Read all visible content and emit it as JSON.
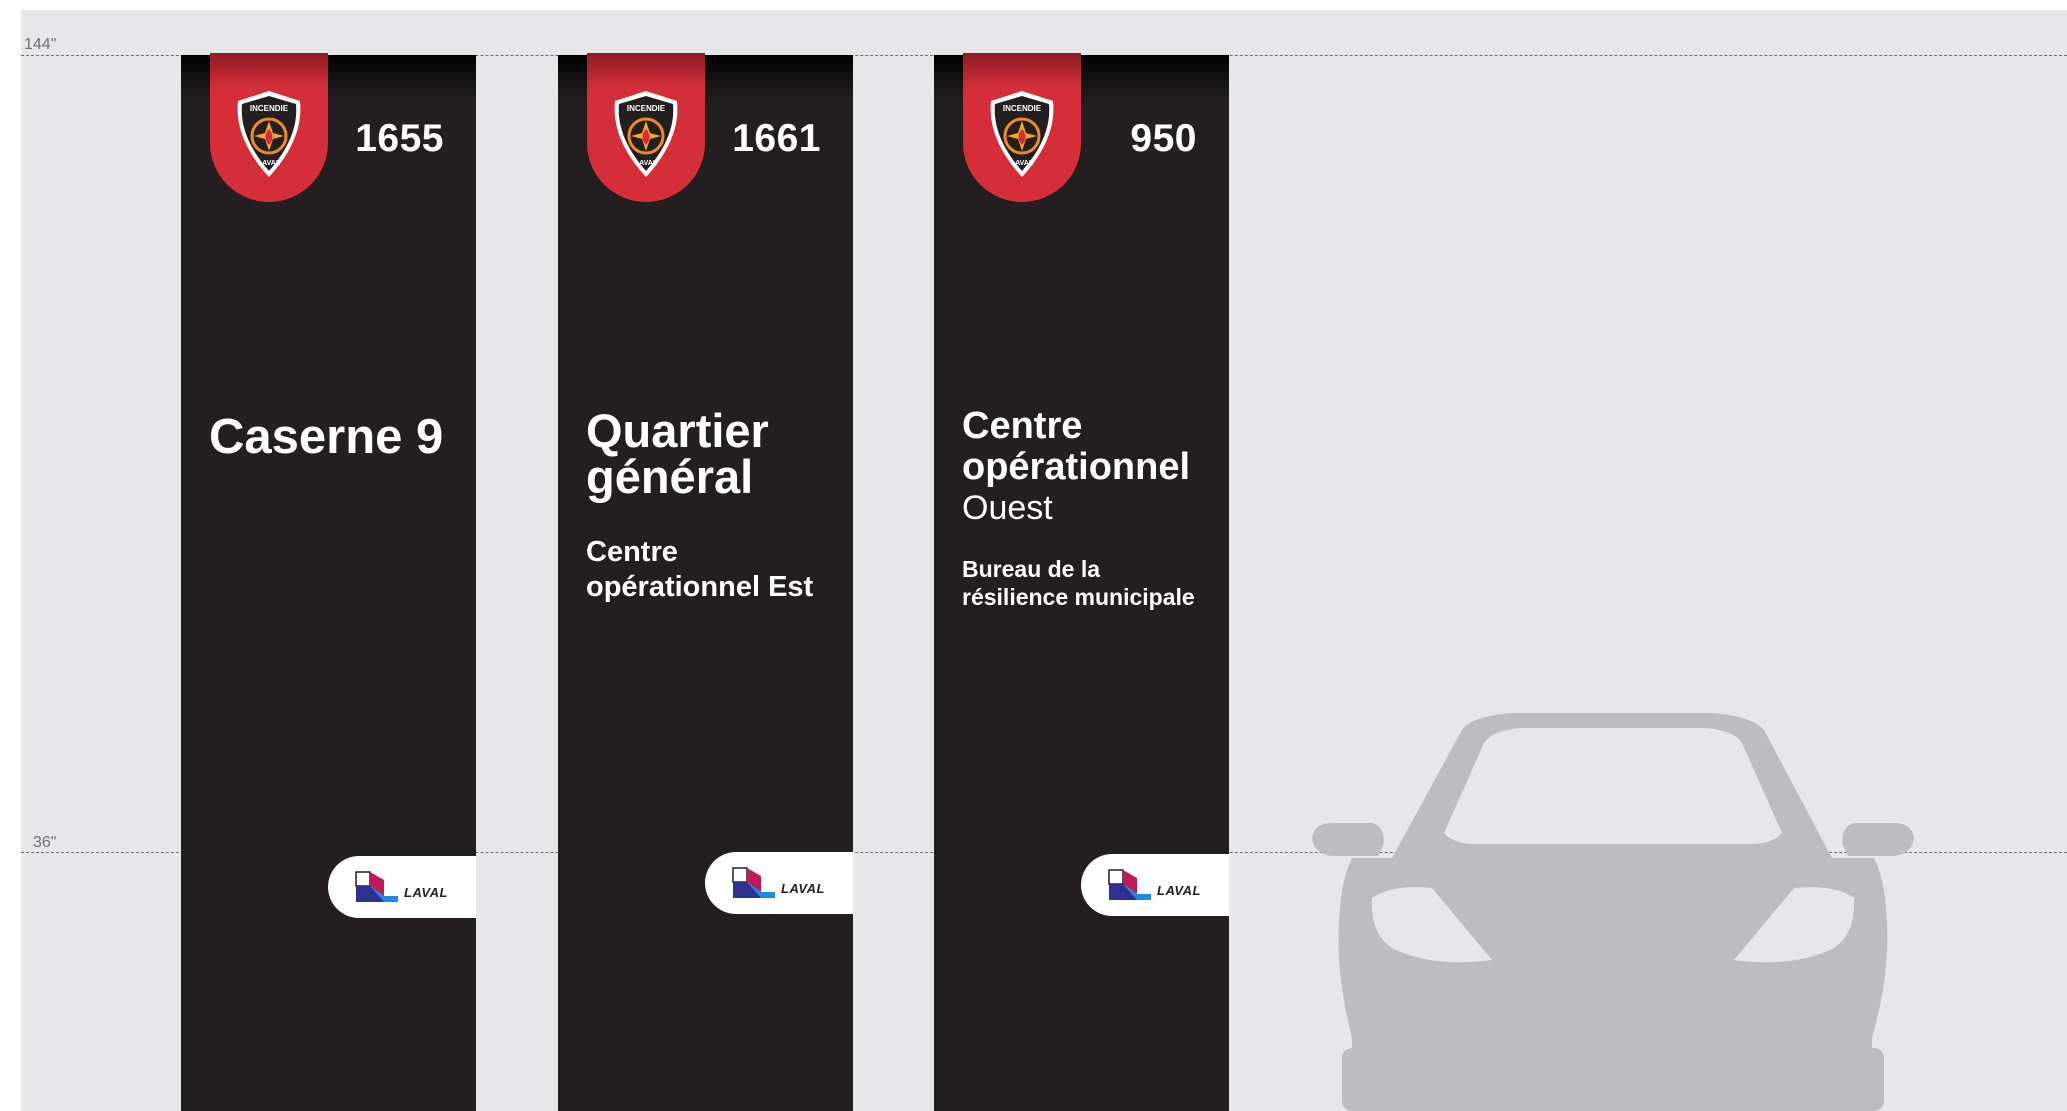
{
  "guides": {
    "top_label": "144\"",
    "bottom_label": "36\""
  },
  "pylons": [
    {
      "number": "1655",
      "title_line1": "Caserne 9",
      "title_line2": "",
      "title_light": "",
      "sub_line1": "",
      "sub_line2": "",
      "badge_top_text": "INCENDIE",
      "badge_bottom_text": "LAVAL",
      "logo_text": "LAVAL"
    },
    {
      "number": "1661",
      "title_line1": "Quartier",
      "title_line2": "général",
      "title_light": "",
      "sub_line1": "Centre",
      "sub_line2": "opérationnel Est",
      "badge_top_text": "INCENDIE",
      "badge_bottom_text": "LAVAL",
      "logo_text": "LAVAL"
    },
    {
      "number": "950",
      "title_line1": "Centre",
      "title_line2": "opérationnel",
      "title_light": "Ouest",
      "sub_line1": "Bureau de la",
      "sub_line2": "résilience municipale",
      "badge_top_text": "INCENDIE",
      "badge_bottom_text": "LAVAL",
      "logo_text": "LAVAL"
    }
  ],
  "colors": {
    "background": "#e6e7e9",
    "pylon": "#231f20",
    "tab_red": "#d62e38",
    "car": "#bcbdc0",
    "guide": "#6d6e71"
  },
  "icons": [
    "incendie-laval-badge-icon",
    "laval-logo-icon",
    "car-silhouette-icon"
  ]
}
